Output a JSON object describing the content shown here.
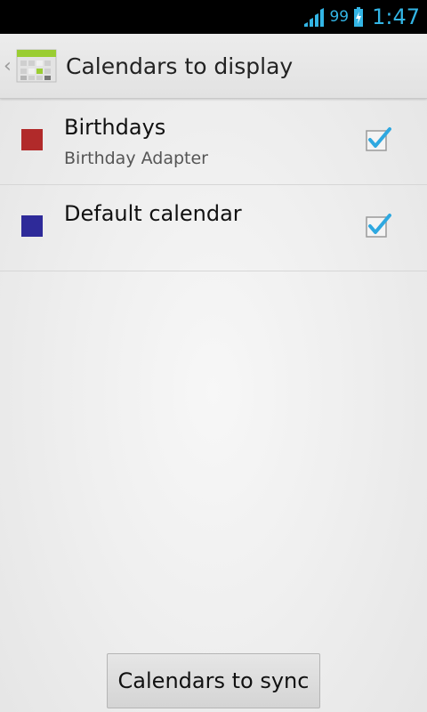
{
  "status_bar": {
    "battery_percent": "99",
    "time": "1:47",
    "accent_color": "#33b5e5",
    "icons": [
      "signal-icon",
      "battery-charging-icon"
    ]
  },
  "action_bar": {
    "title": "Calendars to display",
    "icon": "calendar-app-icon"
  },
  "calendars": [
    {
      "name": "Birthdays",
      "account": "Birthday Adapter",
      "color": "#b12a2a",
      "checked": true
    },
    {
      "name": "Default calendar",
      "account": "",
      "color": "#2e2a99",
      "checked": true
    }
  ],
  "footer": {
    "button_label": "Calendars to sync"
  }
}
